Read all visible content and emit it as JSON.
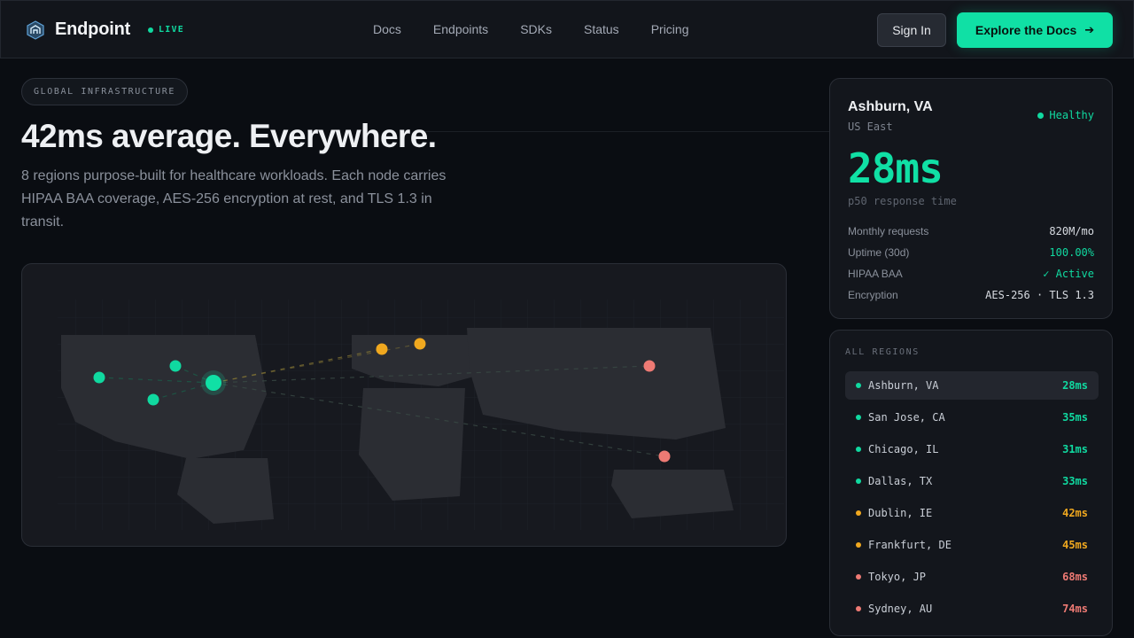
{
  "header": {
    "brand": "Endpoint",
    "live_label": "LIVE",
    "nav": [
      "Docs",
      "Endpoints",
      "SDKs",
      "Status",
      "Pricing"
    ],
    "sign_in": "Sign In",
    "cta": "Explore the Docs",
    "cta_icon": "arrow-right-icon"
  },
  "hero": {
    "badge": "GLOBAL INFRASTRUCTURE",
    "title": "42ms average. Everywhere.",
    "subtitle": "8 regions purpose-built for healthcare workloads. Each node carries HIPAA BAA coverage, AES-256 encryption at rest, and TLS 1.3 in transit."
  },
  "selected_region": {
    "city": "Ashburn, VA",
    "region": "US East",
    "status": "Healthy",
    "latency": "28ms",
    "latency_caption": "p50 response time",
    "stats": [
      {
        "label": "Monthly requests",
        "value": "820M/mo"
      },
      {
        "label": "Uptime (30d)",
        "value": "100.00%"
      },
      {
        "label": "HIPAA BAA",
        "value": "✓ Active"
      },
      {
        "label": "Encryption",
        "value": "AES-256 · TLS 1.3"
      }
    ]
  },
  "regions": {
    "heading": "ALL REGIONS",
    "items": [
      {
        "name": "Ashburn, VA",
        "latency": "28ms",
        "tier": "fast"
      },
      {
        "name": "San Jose, CA",
        "latency": "35ms",
        "tier": "fast"
      },
      {
        "name": "Chicago, IL",
        "latency": "31ms",
        "tier": "fast"
      },
      {
        "name": "Dallas, TX",
        "latency": "33ms",
        "tier": "fast"
      },
      {
        "name": "Dublin, IE",
        "latency": "42ms",
        "tier": "medium"
      },
      {
        "name": "Frankfurt, DE",
        "latency": "45ms",
        "tier": "medium"
      },
      {
        "name": "Tokyo, JP",
        "latency": "68ms",
        "tier": "slow"
      },
      {
        "name": "Sydney, AU",
        "latency": "74ms",
        "tier": "slow"
      }
    ]
  },
  "colors": {
    "fast": "#10d9a0",
    "medium": "#f0a81f",
    "slow": "#ee7a74",
    "accent": "#10e0a5",
    "background": "#0a0d12"
  }
}
